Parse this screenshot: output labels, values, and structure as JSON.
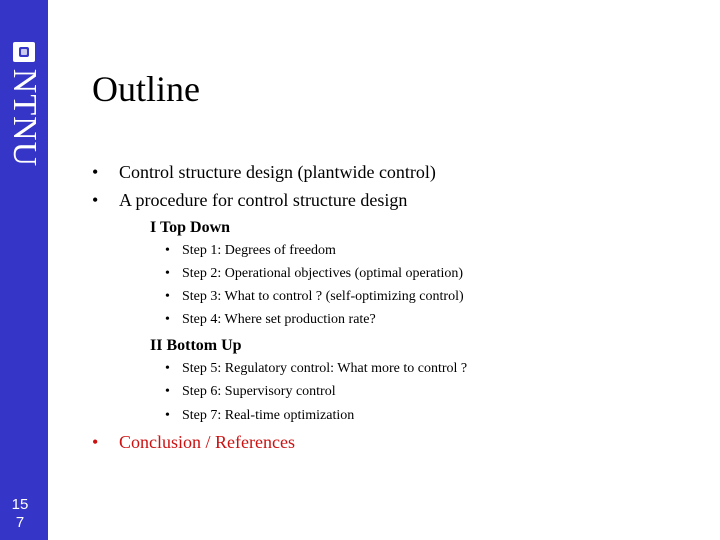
{
  "sidebar": {
    "logo_text": "NTNU",
    "page_number_line1": "15",
    "page_number_line2": "7",
    "color": "#3535c8"
  },
  "slide": {
    "title": "Outline",
    "bullet_glyph": "•",
    "top_items": [
      "Control structure design (plantwide control)",
      "A procedure for control structure design"
    ],
    "sections": [
      {
        "heading": "I Top Down",
        "steps": [
          "Step 1: Degrees of freedom",
          "Step 2: Operational objectives (optimal operation)",
          "Step 3: What to control ? (self-optimizing control)",
          "Step 4: Where set production rate?"
        ]
      },
      {
        "heading": "II Bottom Up",
        "steps": [
          "Step 5: Regulatory control: What more to control ?",
          "Step 6: Supervisory control",
          "Step 7: Real-time optimization"
        ]
      }
    ],
    "final_item": "Conclusion / References",
    "final_item_color": "#cc1111"
  }
}
